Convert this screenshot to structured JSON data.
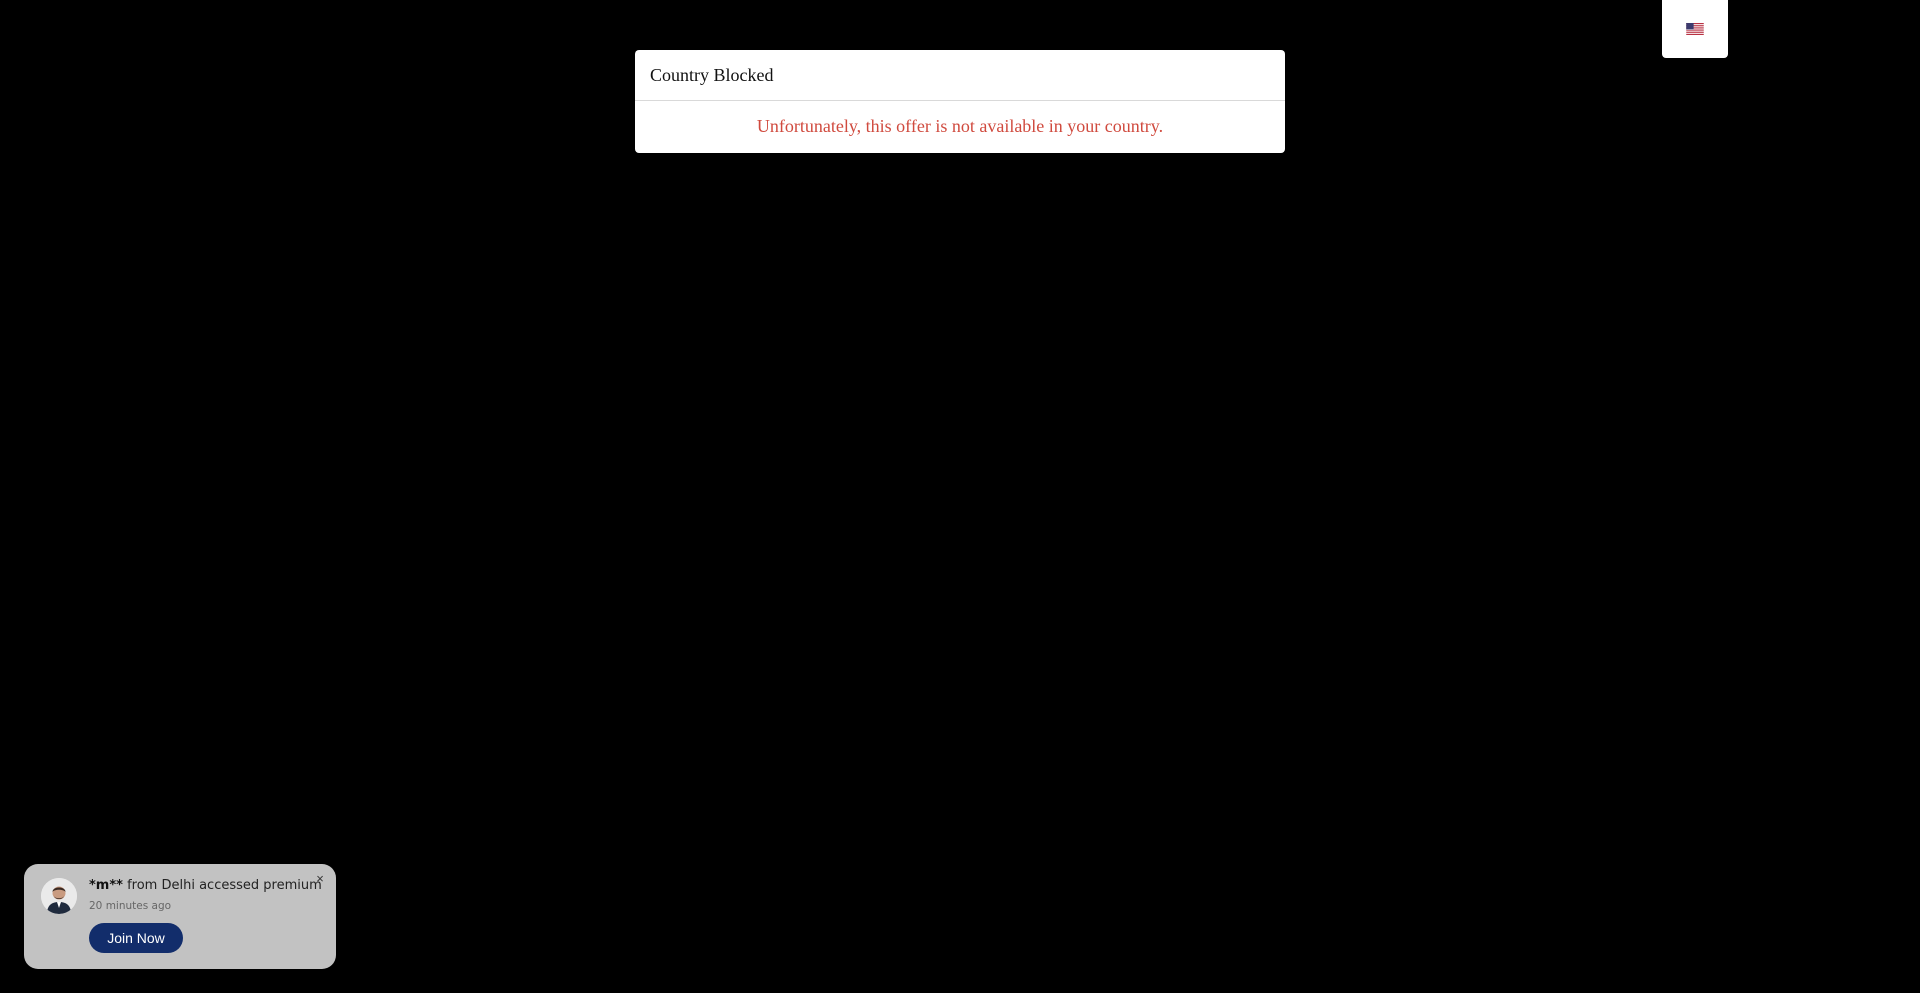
{
  "language_switcher": {
    "icon": "us-flag-icon"
  },
  "modal": {
    "title": "Country Blocked",
    "message": "Unfortunately, this offer is not available in your country.",
    "message_color": "#d04a3e"
  },
  "toast": {
    "user": "*m**",
    "activity": " from Delhi accessed premium",
    "time": "20 minutes ago",
    "button_label": "Join Now",
    "close_icon": "close-icon",
    "close_glyph": "×",
    "avatar_icon": "avatar",
    "button_color": "#122d6b",
    "background_color": "#c2c2c2"
  }
}
